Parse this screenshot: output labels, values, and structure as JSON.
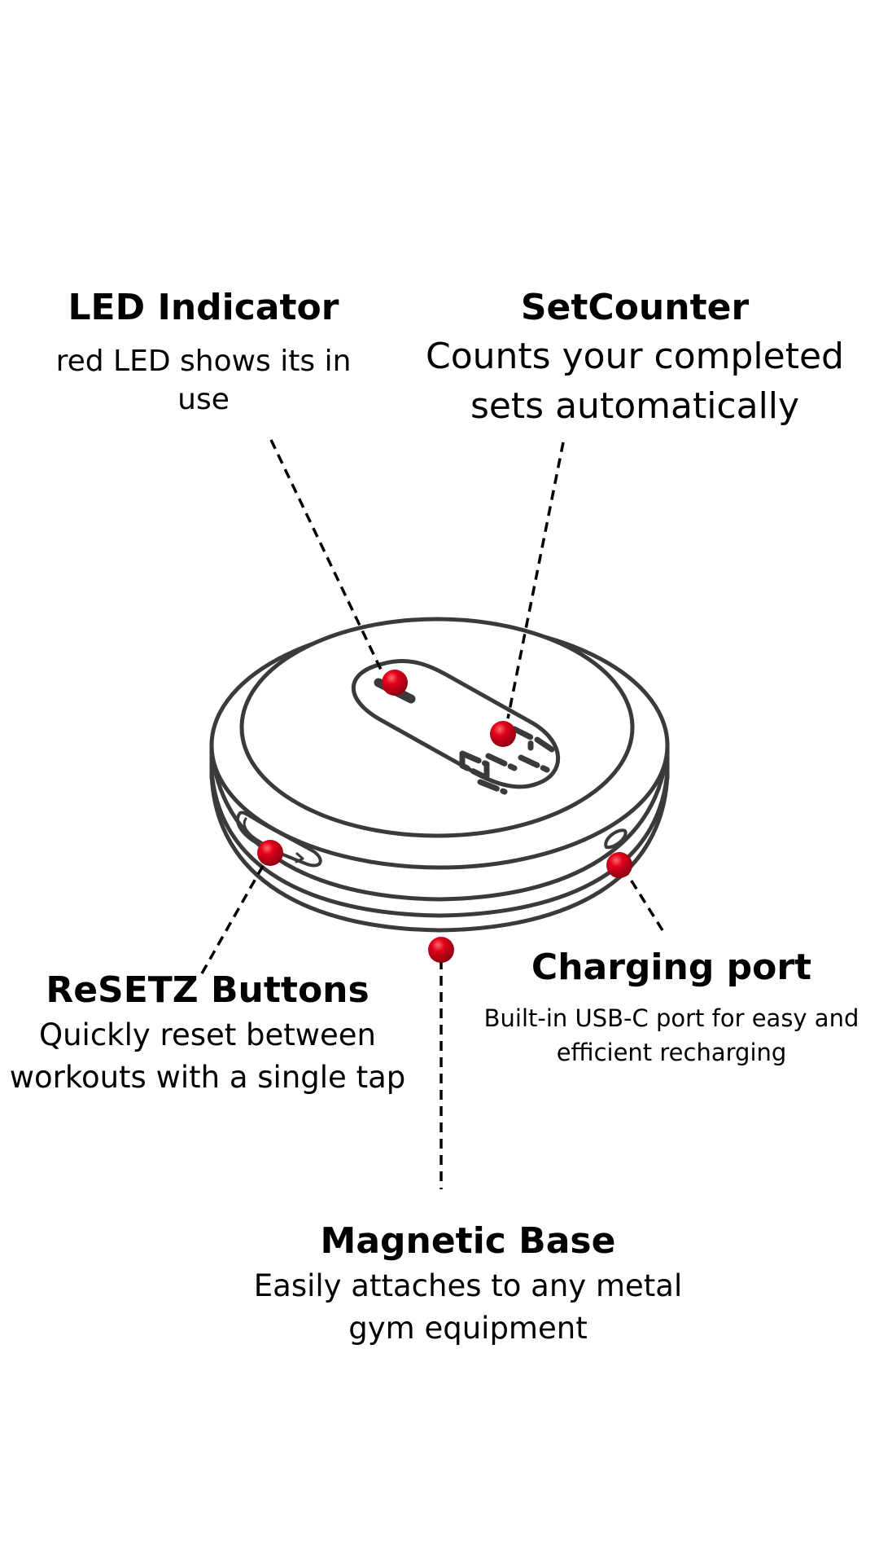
{
  "colors": {
    "outline": "#3a3a3a",
    "marker": "#d4001a",
    "text": "#000000",
    "background": "#ffffff"
  },
  "callouts": {
    "led": {
      "title": "LED Indicator",
      "description": "red LED shows its in use"
    },
    "set_counter": {
      "title": "SetCounter",
      "description": "Counts your completed sets automatically"
    },
    "reset_buttons": {
      "title": "ReSETZ Buttons",
      "description": "Quickly reset between workouts with a single tap"
    },
    "charging_port": {
      "title": "Charging port",
      "description": "Built-in USB-C port for easy and efficient recharging"
    },
    "magnetic_base": {
      "title": "Magnetic Base",
      "description": "Easily attaches to any metal gym equipment"
    }
  }
}
